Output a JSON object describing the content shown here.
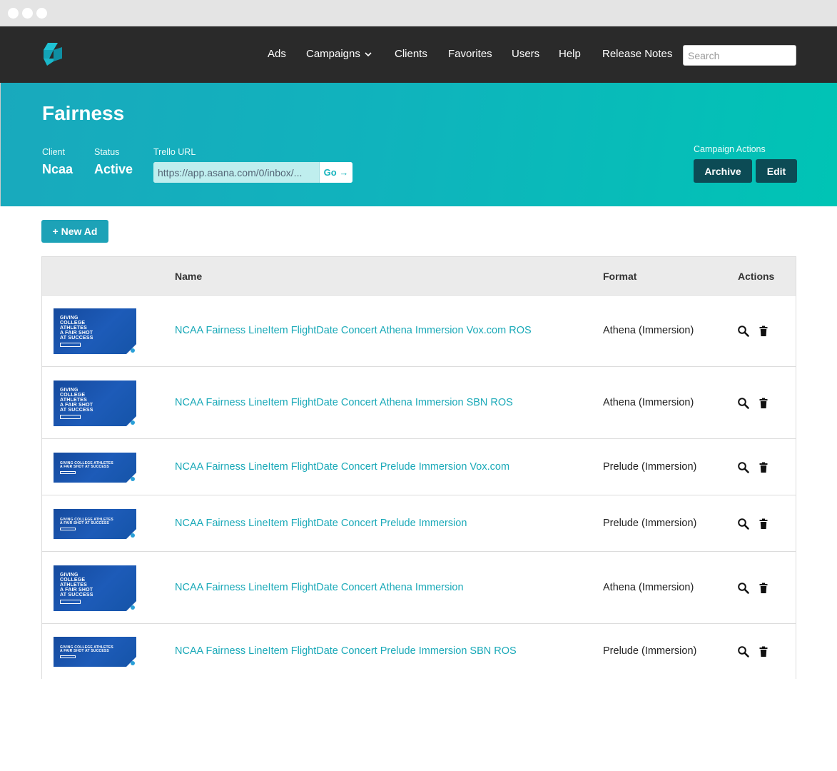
{
  "nav": {
    "items": [
      "Ads",
      "Campaigns",
      "Clients",
      "Favorites",
      "Users",
      "Help",
      "Release Notes"
    ],
    "search_placeholder": "Search"
  },
  "campaign": {
    "title": "Fairness",
    "client_label": "Client",
    "client_value": "Ncaa",
    "status_label": "Status",
    "status_value": "Active",
    "trello_label": "Trello URL",
    "trello_value": "https://app.asana.com/0/inbox/...",
    "go_label": "Go →",
    "actions_label": "Campaign Actions",
    "archive_label": "Archive",
    "edit_label": "Edit"
  },
  "new_ad_label": "+ New Ad",
  "table": {
    "headers": {
      "name": "Name",
      "format": "Format",
      "actions": "Actions"
    },
    "rows": [
      {
        "name": "NCAA Fairness LineItem FlightDate Concert Athena Immersion Vox.com ROS",
        "format": "Athena (Immersion)",
        "thumb": "athena"
      },
      {
        "name": "NCAA Fairness LineItem FlightDate Concert Athena Immersion SBN ROS",
        "format": "Athena (Immersion)",
        "thumb": "athena"
      },
      {
        "name": "NCAA Fairness LineItem FlightDate Concert Prelude Immersion Vox.com",
        "format": "Prelude (Immersion)",
        "thumb": "prelude"
      },
      {
        "name": "NCAA Fairness LineItem FlightDate Concert Prelude Immersion",
        "format": "Prelude (Immersion)",
        "thumb": "prelude"
      },
      {
        "name": "NCAA Fairness LineItem FlightDate Concert Athena Immersion",
        "format": "Athena (Immersion)",
        "thumb": "athena"
      },
      {
        "name": "NCAA Fairness LineItem FlightDate Concert Prelude Immersion SBN ROS",
        "format": "Prelude (Immersion)",
        "thumb": "prelude"
      }
    ]
  },
  "thumb_text": {
    "athena": [
      "GIVING",
      "COLLEGE",
      "ATHLETES",
      "A FAIR SHOT",
      "AT SUCCESS"
    ],
    "prelude": [
      "GIVING COLLEGE ATHLETES",
      "A FAIR SHOT AT SUCCESS"
    ]
  },
  "icons": {
    "logo": "brand-logo-icon",
    "view": "search-icon",
    "delete": "trash-icon",
    "dropdown": "chevron-down-icon"
  },
  "colors": {
    "nav_bg": "#2a2a2a",
    "hero_start": "#19a9bd",
    "hero_end": "#00c4b5",
    "link": "#1aa9b8",
    "dark_button": "#0c4b55",
    "primary_button": "#1da2b7"
  }
}
